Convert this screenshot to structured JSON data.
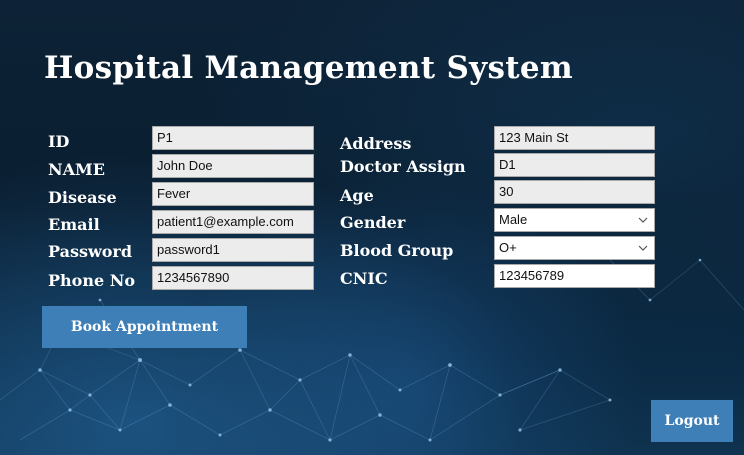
{
  "title": "Hospital Management System",
  "labels": {
    "id": "ID",
    "name": "NAME",
    "disease": "Disease",
    "email": "Email",
    "password": "Password",
    "phone": "Phone No",
    "address": "Address",
    "doctor_assign": "Doctor Assign",
    "age": "Age",
    "gender": "Gender",
    "blood_group": "Blood Group",
    "cnic": "CNIC"
  },
  "values": {
    "id": "P1",
    "name": "John Doe",
    "disease": "Fever",
    "email": "patient1@example.com",
    "password": "password1",
    "phone": "1234567890",
    "address": "123 Main St",
    "doctor_assign": "D1",
    "age": "30",
    "gender": "Male",
    "blood_group": "O+",
    "cnic": "123456789"
  },
  "buttons": {
    "book_appointment": "Book Appointment",
    "logout": "Logout"
  },
  "colors": {
    "button": "#3f7fb8",
    "background": "#0d2236"
  }
}
